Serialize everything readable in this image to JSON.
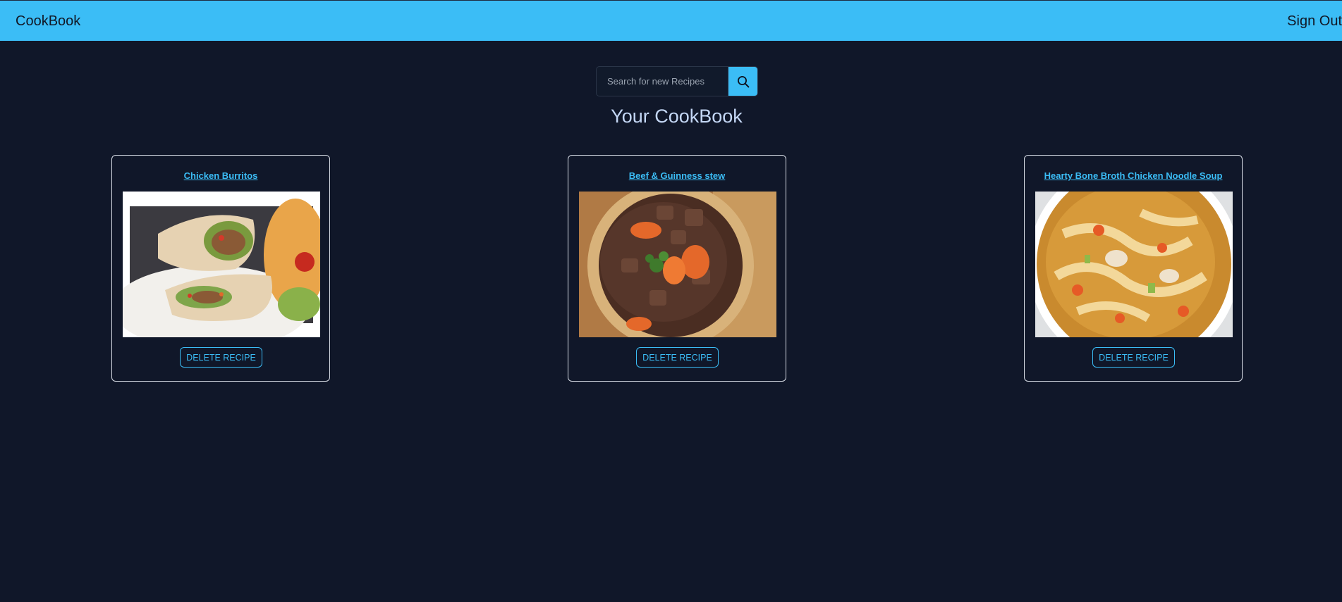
{
  "header": {
    "brand": "CookBook",
    "sign_out_label": "Sign Out"
  },
  "search": {
    "placeholder": "Search for new Recipes",
    "value": "",
    "button_icon": "search-icon"
  },
  "page_title": "Your CookBook",
  "recipes": [
    {
      "title": "Chicken Burritos",
      "delete_label": "DELETE RECIPE"
    },
    {
      "title": "Beef & Guinness stew",
      "delete_label": "DELETE RECIPE"
    },
    {
      "title": "Hearty Bone Broth Chicken Noodle Soup",
      "delete_label": "DELETE RECIPE"
    }
  ],
  "colors": {
    "accent": "#3bbdf6",
    "background": "#101729",
    "title_text": "#c4d7f5",
    "card_border": "#d8dde6"
  }
}
